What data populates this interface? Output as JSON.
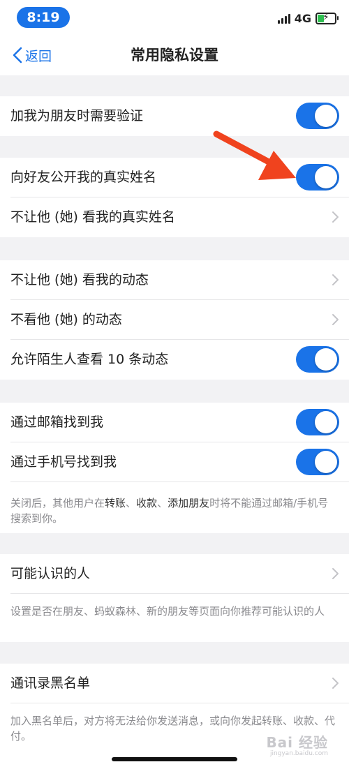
{
  "status": {
    "time": "8:19",
    "network": "4G"
  },
  "nav": {
    "back_label": "返回",
    "title": "常用隐私设置"
  },
  "sections": {
    "verify": {
      "label": "加我为朋友时需要验证",
      "enabled": true
    },
    "realname": {
      "public_label": "向好友公开我的真实姓名",
      "public_enabled": true,
      "hide_label": "不让他 (她) 看我的真实姓名"
    },
    "moments": {
      "hide_mine_label": "不让他 (她) 看我的动态",
      "hide_theirs_label": "不看他 (她) 的动态",
      "strangers_label": "允许陌生人查看 10 条动态",
      "strangers_enabled": true
    },
    "find": {
      "email_label": "通过邮箱找到我",
      "email_enabled": true,
      "phone_label": "通过手机号找到我",
      "phone_enabled": true,
      "note_prefix": "关闭后，其他用户在",
      "note_k1": "转账",
      "note_sep1": "、",
      "note_k2": "收款",
      "note_sep2": "、",
      "note_k3": "添加朋友",
      "note_suffix": "时将不能通过邮箱/手机号搜索到你。"
    },
    "people": {
      "label": "可能认识的人",
      "note": "设置是否在朋友、蚂蚁森林、新的朋友等页面向你推荐可能认识的人"
    },
    "blacklist": {
      "label": "通讯录黑名单",
      "note": "加入黑名单后，对方将无法给你发送消息，或向你发起转账、收款、代付。"
    }
  },
  "watermark": {
    "text": "Bai 经验",
    "sub": "jingyan.baidu.com"
  },
  "colors": {
    "accent": "#1a73e8",
    "arrow": "#f0431e",
    "background": "#f2f2f4"
  },
  "icons": [
    "back-chevron-icon",
    "signal-icon",
    "battery-icon",
    "chevron-right-icon",
    "annotation-arrow-icon"
  ]
}
